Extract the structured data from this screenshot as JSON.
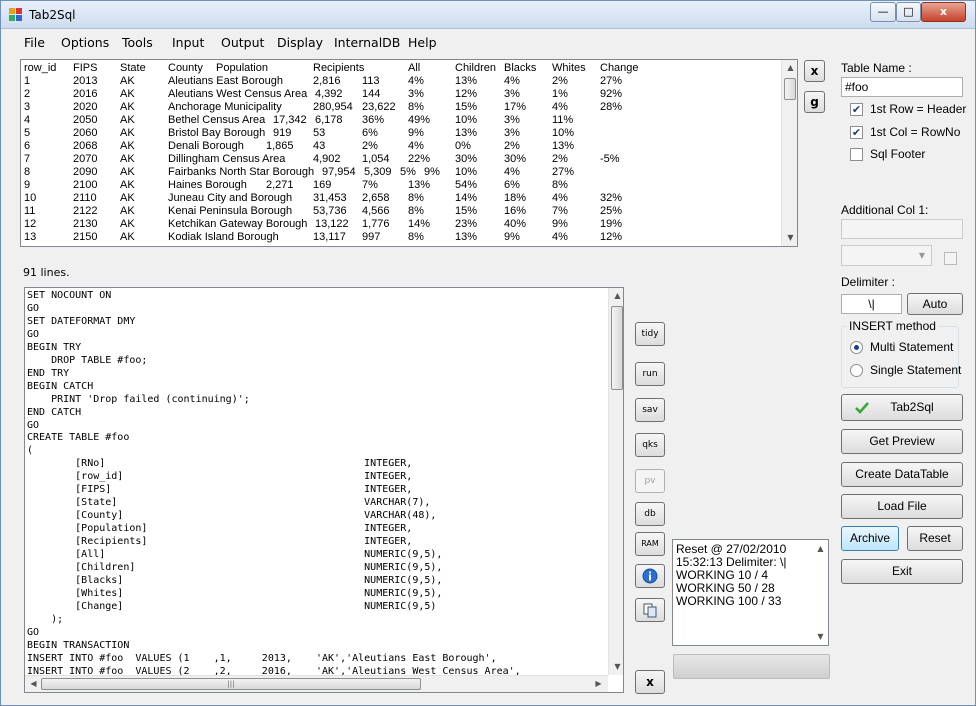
{
  "window": {
    "title": "Tab2Sql",
    "min": "—",
    "max": "□",
    "close": "x"
  },
  "menu": [
    "File",
    "Options",
    "Tools",
    "Input",
    "Output",
    "Display",
    "InternalDB",
    "Help"
  ],
  "table": {
    "headers": [
      "row_id",
      "FIPS",
      "State",
      "County",
      "Population",
      "Recipients",
      "All",
      "Children",
      "Blacks",
      "Whites",
      "Change"
    ],
    "rows": [
      [
        "1",
        "2013",
        "AK",
        "Aleutians East Borough",
        "",
        "2,816",
        "113",
        "4%",
        "13%",
        "4%",
        "2%",
        "27%"
      ],
      [
        "2",
        "2016",
        "AK",
        "Aleutians West Census Area",
        "",
        "4,392",
        "144",
        "3%",
        "12%",
        "3%",
        "1%",
        "92%"
      ],
      [
        "3",
        "2020",
        "AK",
        "Anchorage Municipality",
        "",
        "280,954",
        "23,622",
        "8%",
        "15%",
        "17%",
        "4%",
        "28%"
      ],
      [
        "4",
        "2050",
        "AK",
        "Bethel Census Area",
        "17,342",
        "6,178",
        "36%",
        "49%",
        "10%",
        "3%",
        "11%",
        ""
      ],
      [
        "5",
        "2060",
        "AK",
        "Bristol Bay Borough",
        "919",
        "53",
        "6%",
        "9%",
        "13%",
        "3%",
        "10%",
        ""
      ],
      [
        "6",
        "2068",
        "AK",
        "Denali Borough",
        "1,865",
        "43",
        "2%",
        "4%",
        "0%",
        "2%",
        "13%",
        ""
      ],
      [
        "7",
        "2070",
        "AK",
        "Dillingham Census Area",
        "",
        "4,902",
        "1,054",
        "22%",
        "30%",
        "30%",
        "2%",
        "-5%"
      ],
      [
        "8",
        "2090",
        "AK",
        "Fairbanks North Star Borough",
        "97,954",
        "5,309",
        "5%",
        "9%",
        "10%",
        "4%",
        "27%",
        ""
      ],
      [
        "9",
        "2100",
        "AK",
        "Haines Borough",
        "2,271",
        "169",
        "7%",
        "13%",
        "54%",
        "6%",
        "8%",
        ""
      ],
      [
        "10",
        "2110",
        "AK",
        "Juneau City and Borough",
        "",
        "31,453",
        "2,658",
        "8%",
        "14%",
        "18%",
        "4%",
        "32%"
      ],
      [
        "11",
        "2122",
        "AK",
        "Kenai Peninsula Borough",
        "",
        "53,736",
        "4,566",
        "8%",
        "15%",
        "16%",
        "7%",
        "25%"
      ],
      [
        "12",
        "2130",
        "AK",
        "Ketchikan Gateway Borough",
        "",
        "13,122",
        "1,776",
        "14%",
        "23%",
        "40%",
        "9%",
        "19%"
      ],
      [
        "13",
        "2150",
        "AK",
        "Kodiak Island Borough",
        "",
        "13,117",
        "997",
        "8%",
        "13%",
        "9%",
        "4%",
        "12%"
      ]
    ]
  },
  "lines_count": "91 lines.",
  "sql": {
    "text": "SET NOCOUNT ON\nGO\nSET DATEFORMAT DMY\nGO\nBEGIN TRY\n    DROP TABLE #foo;\nEND TRY\nBEGIN CATCH\n    PRINT 'Drop failed (continuing)';\nEND CATCH\nGO\nCREATE TABLE #foo\n(\n        [RNo]                                           INTEGER,\n        [row_id]                                        INTEGER,\n        [FIPS]                                          INTEGER,\n        [State]                                         VARCHAR(7),\n        [County]                                        VARCHAR(48),\n        [Population]                                    INTEGER,\n        [Recipients]                                    INTEGER,\n        [All]                                           NUMERIC(9,5),\n        [Children]                                      NUMERIC(9,5),\n        [Blacks]                                        NUMERIC(9,5),\n        [Whites]                                        NUMERIC(9,5),\n        [Change]                                        NUMERIC(9,5)\n    );\nGO\nBEGIN TRANSACTION\nINSERT INTO #foo  VALUES (1    ,1,     2013,    'AK','Aleutians East Borough',\nINSERT INTO #foo  VALUES (2    ,2,     2016,    'AK','Aleutians West Census Area',"
  },
  "side_buttons": {
    "tidy": "tidy",
    "run": "run",
    "sav": "sav",
    "qks": "qks",
    "pv": "pv",
    "db": "db",
    "ram": "RAM",
    "x_bottom": "x"
  },
  "top_buttons": {
    "x": "x",
    "g": "g"
  },
  "log": [
    "Reset @ 27/02/2010",
    "15:32:13 Delimiter: \\|",
    "WORKING 10 / 4",
    "WORKING 50 / 28",
    "WORKING 100 / 33"
  ],
  "right": {
    "table_name_label": "Table Name :",
    "table_name_value": "#foo",
    "cb_header": "1st Row = Header",
    "cb_rowno": "1st Col = RowNo",
    "cb_footer": "Sql Footer",
    "additional_col_label": "Additional Col 1:",
    "delimiter_label": "Delimiter :",
    "delimiter_value": "\\|",
    "auto_button": "Auto",
    "insert_method_label": "INSERT method",
    "radio_multi": "Multi Statement",
    "radio_single": "Single Statement",
    "tab2sql_button": "Tab2Sql",
    "get_preview_button": "Get Preview",
    "create_datatable_button": "Create DataTable",
    "load_file_button": "Load File",
    "archive_button": "Archive",
    "reset_button": "Reset",
    "exit_button": "Exit"
  },
  "colors": {
    "accent": "#3c7fb1",
    "check_green": "#3aa53a",
    "info_blue": "#2a6fd1"
  }
}
